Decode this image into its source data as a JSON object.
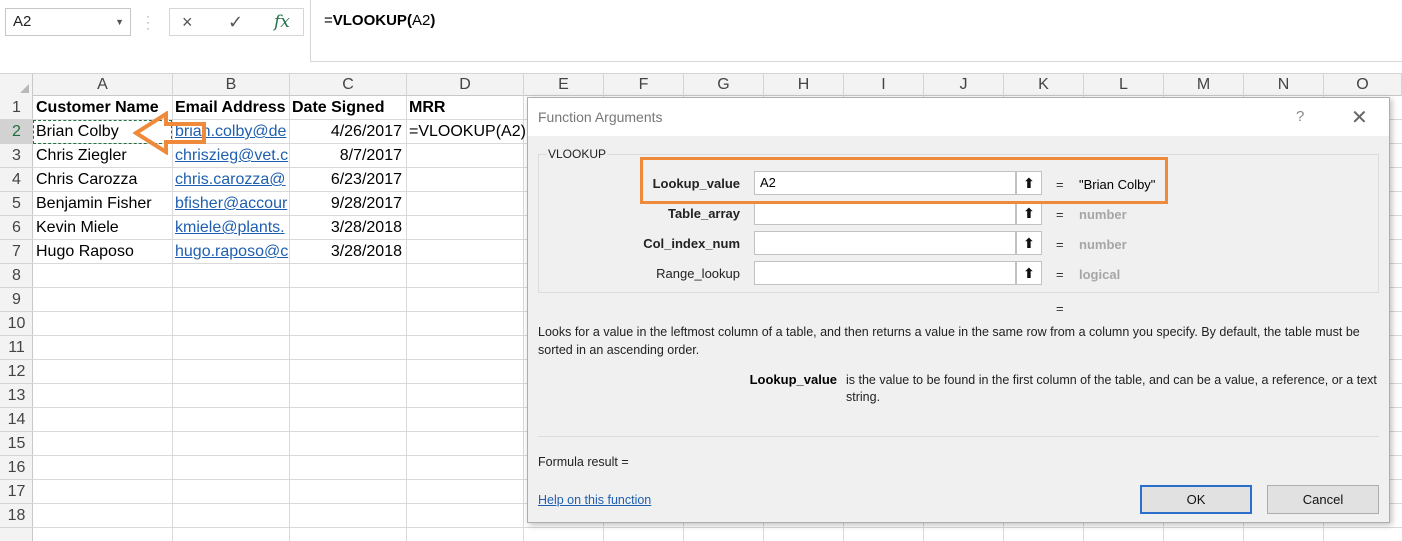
{
  "formula_bar": {
    "name_box": "A2",
    "formula_prefix": "=",
    "formula_func": "VLOOKUP",
    "formula_open": "(",
    "formula_arg": "A2",
    "formula_close": ")",
    "cancel_icon": "×",
    "enter_icon": "✓",
    "fx_icon": "fx"
  },
  "columns": [
    "A",
    "B",
    "C",
    "D",
    "E",
    "F",
    "G",
    "H",
    "I",
    "J",
    "K",
    "L",
    "M",
    "N",
    "O"
  ],
  "rows": [
    "1",
    "2",
    "3",
    "4",
    "5",
    "6",
    "7",
    "8",
    "9",
    "10",
    "11",
    "12",
    "13",
    "14",
    "15",
    "16",
    "17",
    "18"
  ],
  "headers": {
    "a": "Customer Name",
    "b": "Email Address",
    "c": "Date Signed",
    "d": "MRR"
  },
  "records": [
    {
      "name": "Brian Colby",
      "email": "brian.colby@de",
      "date": "4/26/2017",
      "mrr": "=VLOOKUP(A2)"
    },
    {
      "name": "Chris Ziegler",
      "email": "chriszieg@vet.c",
      "date": "8/7/2017",
      "mrr": ""
    },
    {
      "name": "Chris Carozza",
      "email": "chris.carozza@",
      "date": "6/23/2017",
      "mrr": ""
    },
    {
      "name": "Benjamin Fisher",
      "email": "bfisher@accour",
      "date": "9/28/2017",
      "mrr": ""
    },
    {
      "name": "Kevin Miele",
      "email": "kmiele@plants.",
      "date": "3/28/2018",
      "mrr": ""
    },
    {
      "name": "Hugo Raposo",
      "email": "hugo.raposo@c",
      "date": "3/28/2018",
      "mrr": ""
    }
  ],
  "dialog": {
    "title": "Function Arguments",
    "help": "?",
    "close": "✕",
    "group_label": "VLOOKUP",
    "args": [
      {
        "label": "Lookup_value",
        "value": "A2",
        "eq": "=",
        "result": "\"Brian Colby\""
      },
      {
        "label": "Table_array",
        "value": "",
        "eq": "=",
        "result": "number"
      },
      {
        "label": "Col_index_num",
        "value": "",
        "eq": "=",
        "result": "number"
      },
      {
        "label": "Range_lookup",
        "value": "",
        "eq": "=",
        "result": "logical"
      }
    ],
    "result_eq": "=",
    "description": "Looks for a value in the leftmost column of a table, and then returns a value in the same row from a column you specify. By default, the table must be sorted in an ascending order.",
    "arg_desc_name": "Lookup_value",
    "arg_desc_text": "is the value to be found in the first column of the table, and can be a value, a reference, or a text string.",
    "formula_result": "Formula result =",
    "help_link": "Help on this function",
    "ok": "OK",
    "cancel": "Cancel"
  },
  "colors": {
    "highlight": "#ef8a3a",
    "excel_green": "#217346",
    "link": "#1f5fb0"
  }
}
